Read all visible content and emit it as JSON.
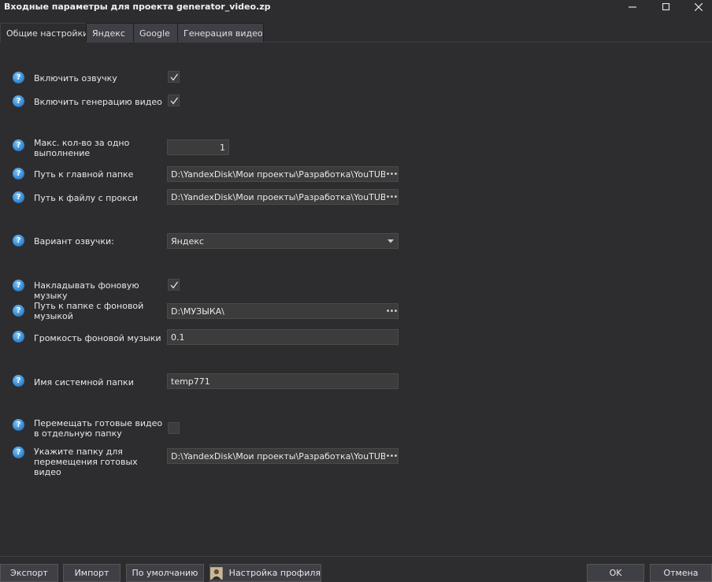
{
  "window": {
    "title": "Входные параметры для проекта generator_video.zp"
  },
  "tabs": [
    {
      "label": "Общие настройки",
      "active": true
    },
    {
      "label": "Яндекс",
      "active": false
    },
    {
      "label": "Google",
      "active": false
    },
    {
      "label": "Генерация видео",
      "active": false
    }
  ],
  "settings": {
    "enable_voice": {
      "label": "Включить озвучку",
      "checked": true
    },
    "enable_video": {
      "label": "Включить генерацию видео",
      "checked": true
    },
    "max_per_run": {
      "label": "Макс. кол-во за одно выполнение",
      "value": "1"
    },
    "main_folder": {
      "label": "Путь к главной папке",
      "value": "D:\\YandexDisk\\Мои проекты\\Разработка\\YouTUBE\\Ge"
    },
    "proxy_file": {
      "label": "Путь к файлу с прокси",
      "value": "D:\\YandexDisk\\Мои проекты\\Разработка\\YouTUBE\\Ge"
    },
    "voice_variant": {
      "label": "Вариант озвучки:",
      "value": "Яндекс"
    },
    "bg_music": {
      "label": "Накладывать фоновую музыку",
      "checked": true
    },
    "music_folder": {
      "label": "Путь к папке с фоновой музыкой",
      "value": "D:\\МУЗЫКА\\"
    },
    "music_volume": {
      "label": "Громкость фоновой музыки",
      "value": "0.1"
    },
    "system_folder": {
      "label": "Имя системной папки",
      "value": "temp771"
    },
    "move_videos": {
      "label": "Перемещать готовые видео в отдельную папку",
      "checked": false
    },
    "move_folder": {
      "label": "Укажите папку для перемещения готовых видео",
      "value": "D:\\YandexDisk\\Мои проекты\\Разработка\\YouTUBE\\Ge"
    }
  },
  "buttons": {
    "export": "Экспорт",
    "import": "Импорт",
    "defaults": "По умолчанию",
    "profile": "Настройка профиля",
    "ok": "OK",
    "cancel": "Отмена"
  },
  "help_glyph": "?",
  "icons": {
    "help": "help-icon",
    "browse": "browse-dots-icon",
    "dropdown": "chevron-down-icon",
    "check": "checkmark-icon",
    "profile": "user-profile-icon"
  },
  "colors": {
    "background": "#2d2d30",
    "field": "#3c3c3c",
    "help_blue": "#3a8fd8",
    "text": "#e8e8e8"
  }
}
